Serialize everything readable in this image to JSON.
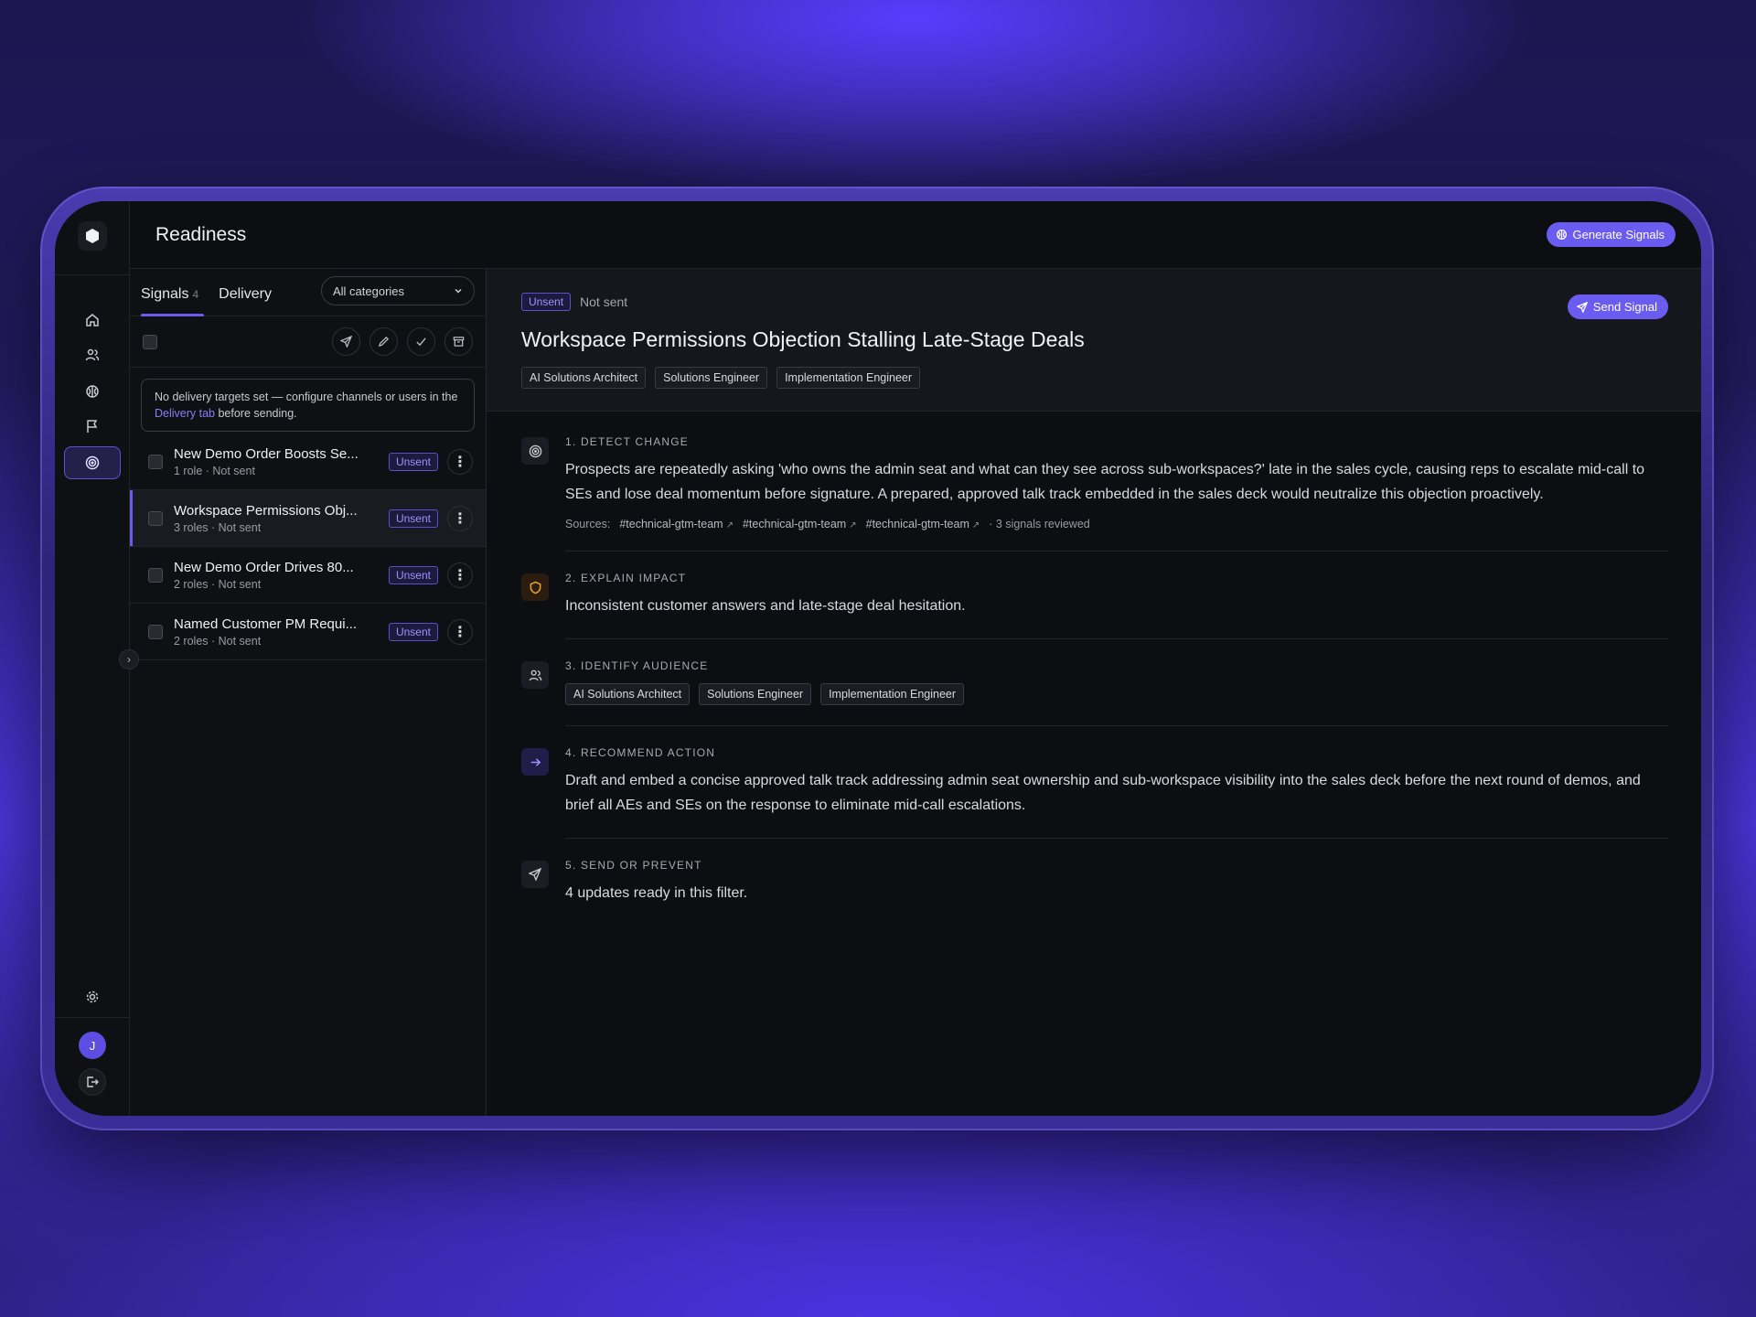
{
  "app": {
    "title": "Readiness",
    "generate_label": "Generate Signals",
    "user_initial": "J"
  },
  "tabs": {
    "signals_label": "Signals",
    "signals_count": "4",
    "delivery_label": "Delivery",
    "filter_value": "All categories"
  },
  "notice": {
    "before": "No delivery targets set — configure channels or users in the ",
    "link": "Delivery tab",
    "after": " before sending."
  },
  "signals": [
    {
      "title": "New Demo Order Boosts Se...",
      "meta": "1 role · Not sent",
      "status": "Unsent"
    },
    {
      "title": "Workspace Permissions Obj...",
      "meta": "3 roles · Not sent",
      "status": "Unsent"
    },
    {
      "title": "New Demo Order Drives 80...",
      "meta": "2 roles · Not sent",
      "status": "Unsent"
    },
    {
      "title": "Named Customer PM Requi...",
      "meta": "2 roles · Not sent",
      "status": "Unsent"
    }
  ],
  "detail": {
    "status_badge": "Unsent",
    "status_text": "Not sent",
    "send_label": "Send Signal",
    "title": "Workspace Permissions Objection Stalling Late-Stage Deals",
    "tags": [
      "AI Solutions Architect",
      "Solutions Engineer",
      "Implementation Engineer"
    ],
    "steps": {
      "detect": {
        "label": "1. DETECT CHANGE",
        "text": "Prospects are repeatedly asking 'who owns the admin seat and what can they see across sub-workspaces?' late in the sales cycle, causing reps to escalate mid-call to SEs and lose deal momentum before signature. A prepared, approved talk track embedded in the sales deck would neutralize this objection proactively.",
        "sources_label": "Sources:",
        "sources": [
          "#technical-gtm-team",
          "#technical-gtm-team",
          "#technical-gtm-team"
        ],
        "reviewed": "· 3 signals reviewed"
      },
      "impact": {
        "label": "2. EXPLAIN IMPACT",
        "text": "Inconsistent customer answers and late-stage deal hesitation."
      },
      "audience": {
        "label": "3. IDENTIFY AUDIENCE",
        "tags": [
          "AI Solutions Architect",
          "Solutions Engineer",
          "Implementation Engineer"
        ]
      },
      "action": {
        "label": "4. RECOMMEND ACTION",
        "text": "Draft and embed a concise approved talk track addressing admin seat ownership and sub-workspace visibility into the sales deck before the next round of demos, and brief all AEs and SEs on the response to eliminate mid-call escalations."
      },
      "send": {
        "label": "5. SEND OR PREVENT",
        "text": "4 updates ready in this filter."
      }
    }
  },
  "colors": {
    "accent": "#6a5cf0",
    "impact_icon": "#f0a030"
  }
}
